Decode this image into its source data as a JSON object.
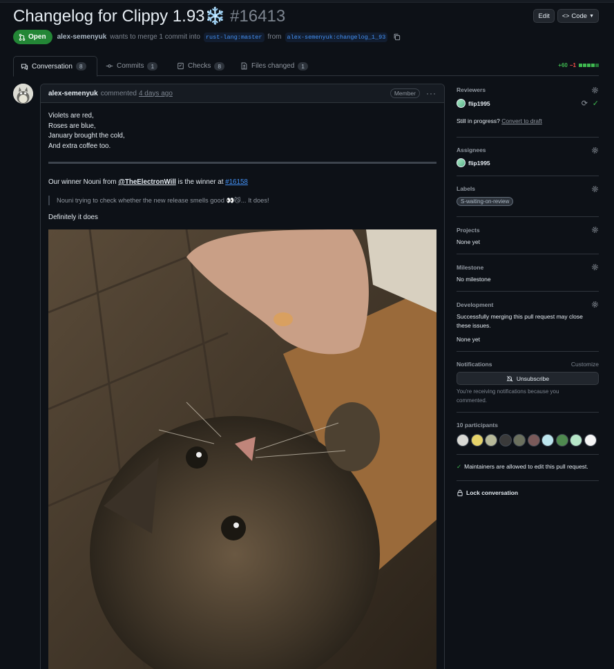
{
  "pr": {
    "title": "Changelog for Clippy 1.93❄️",
    "number": "#16413",
    "status": "Open",
    "author": "alex-semenyuk",
    "merge_text": "wants to merge 1 commit into",
    "base_branch": "rust-lang:master",
    "from_text": "from",
    "head_branch": "alex-semenyuk:changelog_1_93"
  },
  "header_buttons": {
    "edit": "Edit",
    "code": "Code"
  },
  "tabs": [
    {
      "label": "Conversation",
      "count": "8"
    },
    {
      "label": "Commits",
      "count": "1"
    },
    {
      "label": "Checks",
      "count": "8"
    },
    {
      "label": "Files changed",
      "count": "1"
    }
  ],
  "diffstat": {
    "additions": "+60",
    "deletions": "−1"
  },
  "comment": {
    "author": "alex-semenyuk",
    "action": "commented",
    "time": "4 days ago",
    "role": "Member",
    "poem": [
      "Violets are red,",
      "Roses are blue,",
      "January brought the cold,",
      "And extra coffee too."
    ],
    "winner_pre": "Our winner Nouni from",
    "winner_mention": "@TheElectronWill",
    "winner_mid": "is the winner at",
    "winner_link": "#16158",
    "quote": "Nouni trying to check whether the new release smells good 👀😼... It does!",
    "closing": "Definitely it does"
  },
  "sidebar": {
    "reviewers": {
      "heading": "Reviewers",
      "user": "flip1995",
      "progress_text": "Still in progress?",
      "draft_link": "Convert to draft"
    },
    "assignees": {
      "heading": "Assignees",
      "user": "flip1995"
    },
    "labels": {
      "heading": "Labels",
      "label": "S-waiting-on-review"
    },
    "projects": {
      "heading": "Projects",
      "value": "None yet"
    },
    "milestone": {
      "heading": "Milestone",
      "value": "No milestone"
    },
    "development": {
      "heading": "Development",
      "text": "Successfully merging this pull request may close these issues.",
      "value": "None yet"
    },
    "notifications": {
      "heading": "Notifications",
      "customize": "Customize",
      "button": "Unsubscribe",
      "text": "You're receiving notifications because you commented."
    },
    "participants": {
      "heading": "10 participants"
    },
    "maintainers": "Maintainers are allowed to edit this pull request.",
    "lock": "Lock conversation"
  },
  "colors": {
    "open_green": "#238636",
    "link_blue": "#4493f8",
    "bg": "#0d1117"
  }
}
